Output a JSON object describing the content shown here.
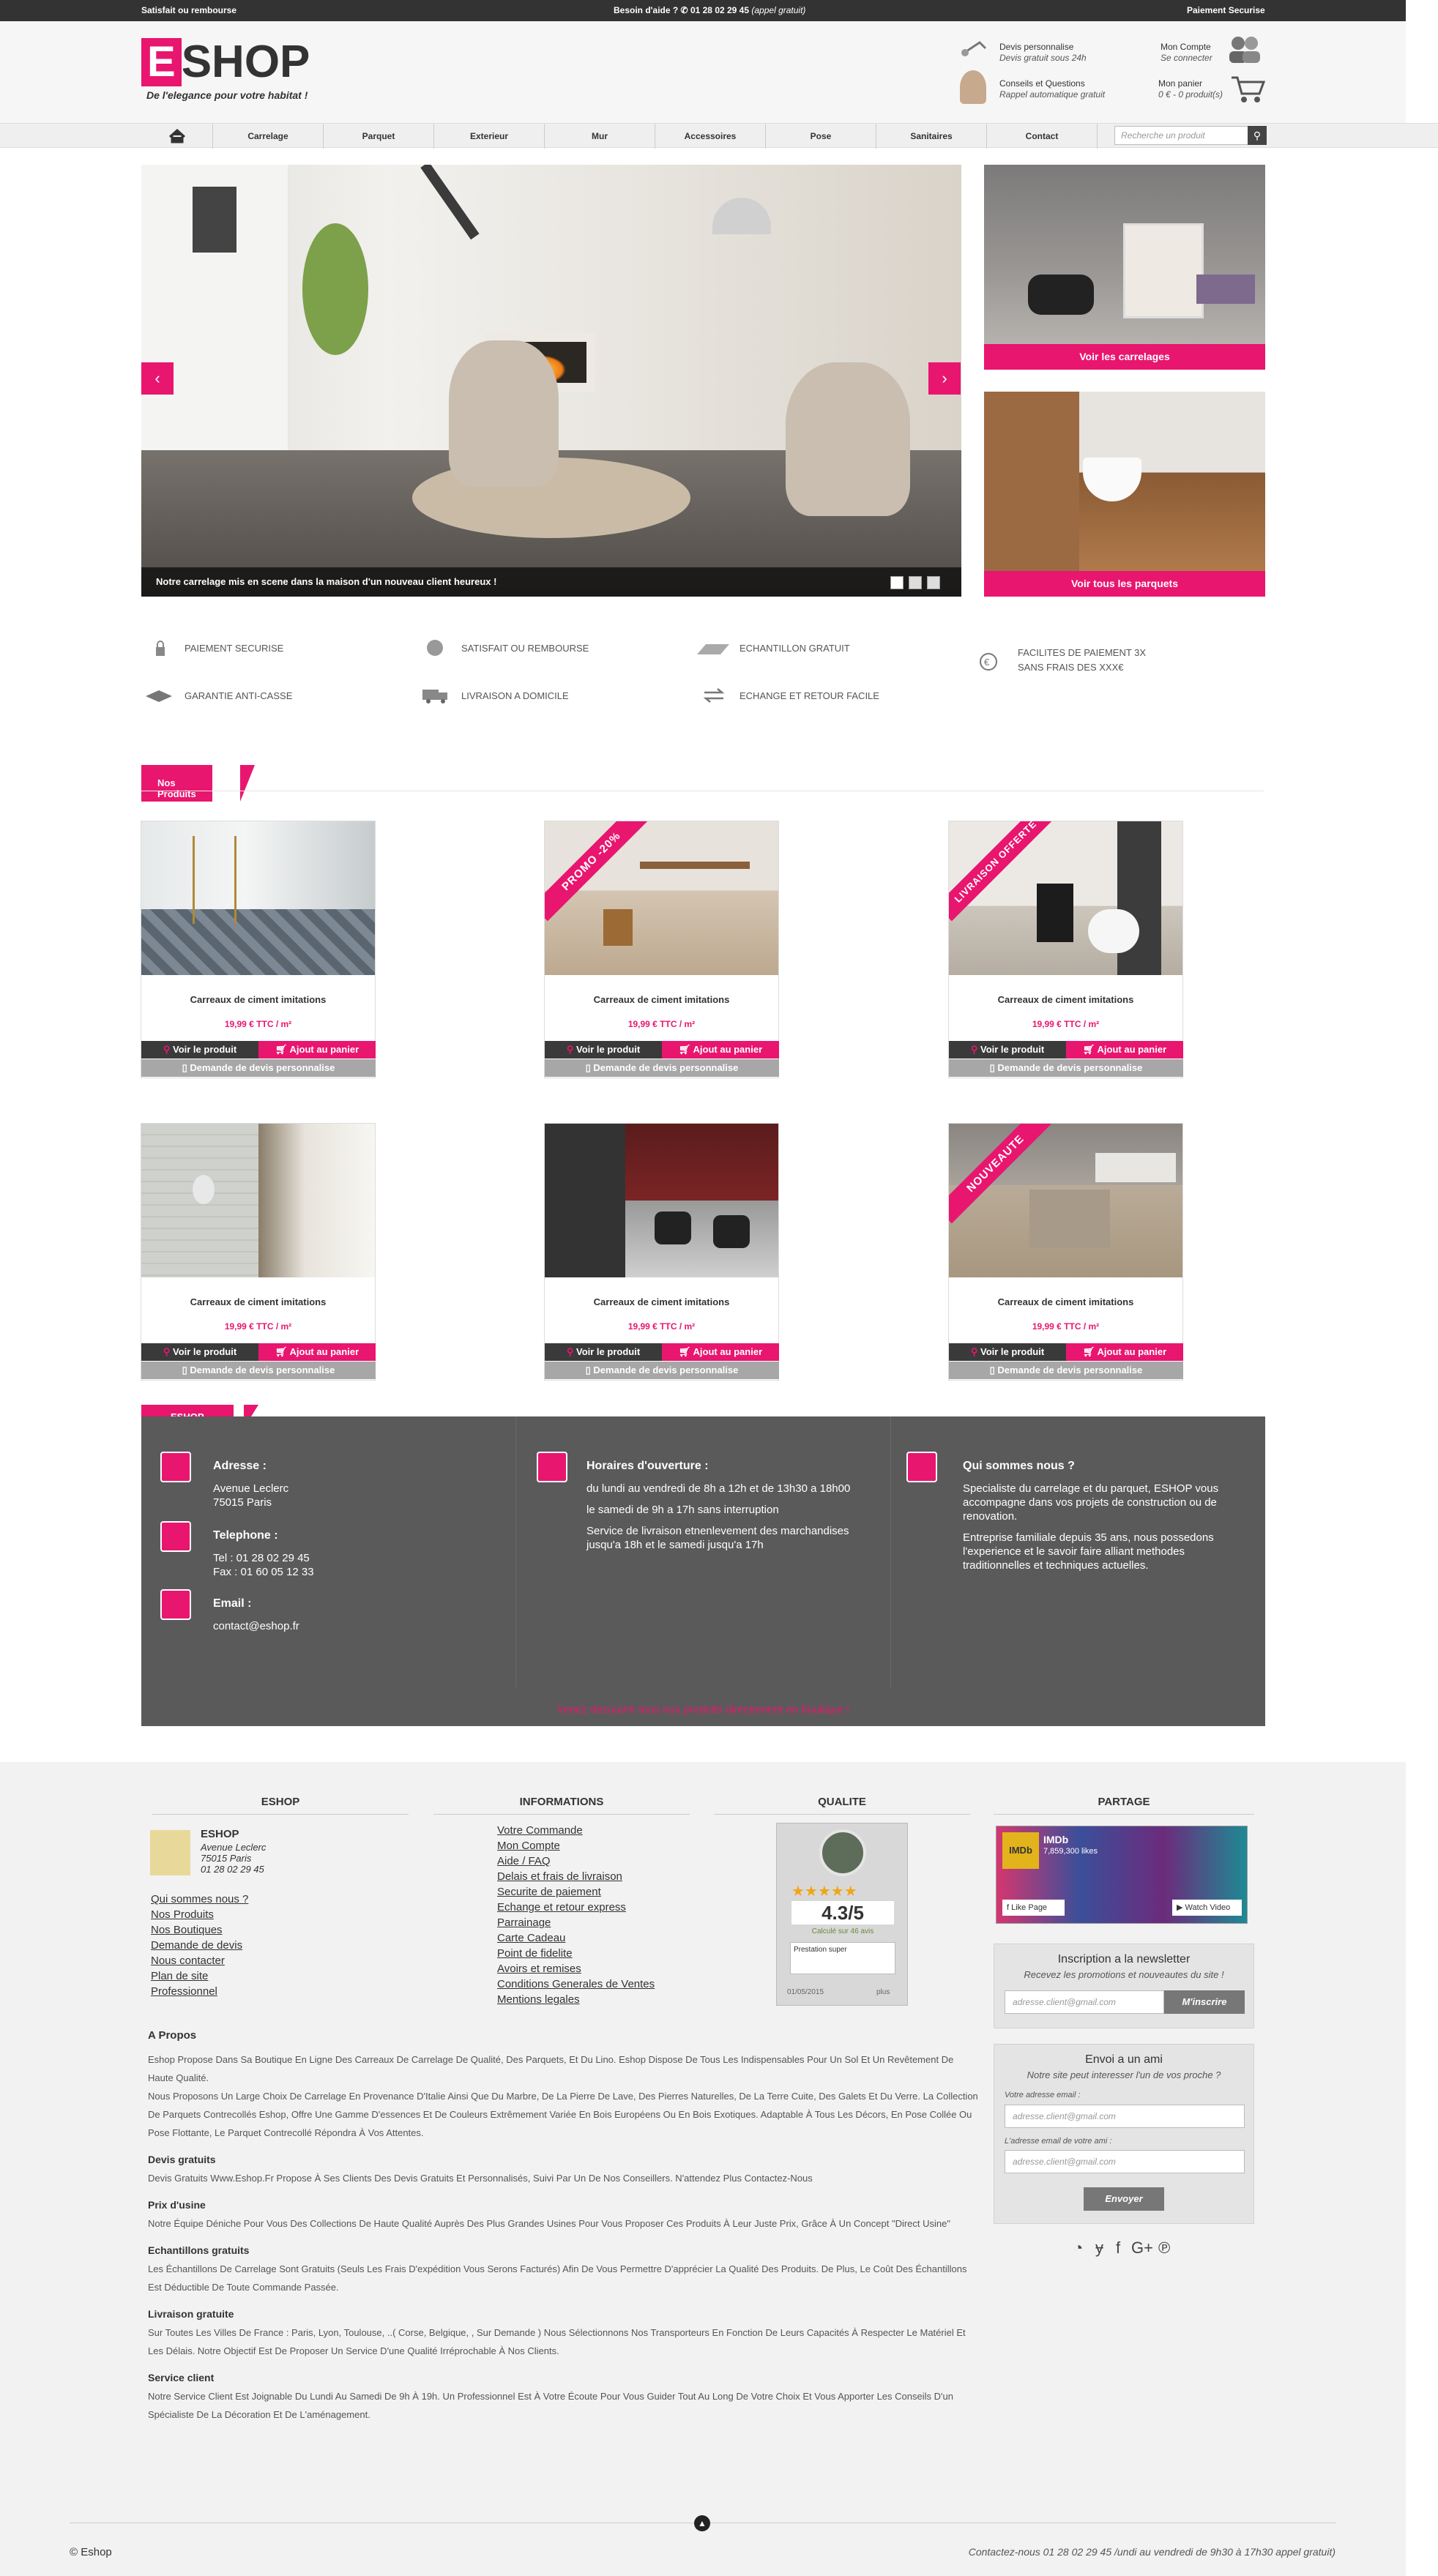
{
  "topbar": {
    "left": "Satisfait ou rembourse",
    "center_prefix": "Besoin d'aide ?",
    "center_phone": "01 28 02 29 45",
    "center_note": "(appel gratuit)",
    "right": "Paiement Securise"
  },
  "header": {
    "logo_letter": "E",
    "logo_rest": "SHOP",
    "slogan": "De l'elegance pour votre habitat !",
    "devis_title": "Devis personnalise",
    "devis_sub": "Devis gratuit sous 24h",
    "conseils_title": "Conseils et Questions",
    "conseils_sub": "Rappel automatique gratuit",
    "account_title": "Mon Compte",
    "account_sub": "Se connecter",
    "cart_title": "Mon panier",
    "cart_sub": "0 € - 0 produit(s)"
  },
  "nav": {
    "home_icon": "home-icon",
    "items": [
      "Carrelage",
      "Parquet",
      "Exterieur",
      "Mur",
      "Accessoires",
      "Pose",
      "Sanitaires",
      "Contact"
    ],
    "search_placeholder": "Recherche un produit"
  },
  "slider": {
    "caption": "Notre carrelage mis en scene dans la maison d'un nouveau client heureux !",
    "prev": "‹",
    "next": "›"
  },
  "side": {
    "carrelages": "Voir les carrelages",
    "parquets": "Voir tous les parquets"
  },
  "features": [
    "PAIEMENT SECURISE",
    "SATISFAIT OU REMBOURSE",
    "ECHANTILLON GRATUIT",
    "FACILITES DE PAIEMENT 3X SANS FRAIS DES XXX€",
    "GARANTIE ANTI-CASSE",
    "LIVRAISON A DOMICILE",
    "ECHANGE ET RETOUR FACILE"
  ],
  "products_section": {
    "title": "Nos Produits"
  },
  "products": [
    {
      "name": "Carreaux de ciment imitations",
      "price": "19,99 € TTC / m²",
      "ribbon": ""
    },
    {
      "name": "Carreaux de ciment imitations",
      "price": "19,99 € TTC / m²",
      "ribbon": "PROMO -20%"
    },
    {
      "name": "Carreaux de ciment imitations",
      "price": "19,99 € TTC / m²",
      "ribbon": "LIVRAISON OFFERTE"
    },
    {
      "name": "Carreaux de ciment imitations",
      "price": "19,99 € TTC / m²",
      "ribbon": ""
    },
    {
      "name": "Carreaux de ciment imitations",
      "price": "19,99 € TTC / m²",
      "ribbon": ""
    },
    {
      "name": "Carreaux de ciment imitations",
      "price": "19,99 € TTC / m²",
      "ribbon": "NOUVEAUTE"
    }
  ],
  "product_buttons": {
    "view": "Voir le produit",
    "cart": "Ajout au panier",
    "quote": "Demande de devis personnalise"
  },
  "eshop_section": {
    "title": "ESHOP",
    "address_title": "Adresse :",
    "address_l1": "Avenue Leclerc",
    "address_l2": "75015 Paris",
    "phone_title": "Telephone :",
    "phone_l1": "Tel : 01 28 02 29 45",
    "phone_l2": "Fax : 01 60 05 12 33",
    "email_title": "Email :",
    "email": "contact@eshop.fr",
    "hours_title": "Horaires d'ouverture :",
    "hours_l1": "du lundi au vendredi de 8h a 12h et de 13h30 a 18h00",
    "hours_l2": "le samedi de 9h a 17h sans interruption",
    "hours_l3": "Service de livraison etnenlevement des marchandises jusqu'a 18h et le samedi jusqu'a 17h",
    "about_title": "Qui sommes nous ?",
    "about_p1": "Specialiste du carrelage et du parquet, ESHOP vous accompagne dans vos projets de construction ou de renovation.",
    "about_p2": "Entreprise familiale depuis 35 ans, nous possedons l'experience et le savoir faire alliant methodes traditionnelles et techniques actuelles.",
    "bottom": "Venez decouvrir tous nos produits directement en boutique !"
  },
  "footer": {
    "col1_title": "ESHOP",
    "company": "ESHOP",
    "addr1": "Avenue Leclerc",
    "addr2": "75015 Paris",
    "addr3": "01 28 02 29 45",
    "col1_links": [
      "Qui sommes nous ?",
      "Nos Produits",
      "Nos Boutiques",
      "Demande de devis",
      "Nous contacter",
      "Plan de site",
      "Professionnel"
    ],
    "col2_title": "INFORMATIONS",
    "col2_links": [
      "Votre Commande",
      "Mon Compte",
      "Aide / FAQ",
      "Delais et frais de livraison",
      "Securite de paiement",
      "Echange et retour express",
      "Parrainage",
      "Carte Cadeau",
      "Point de fidelite",
      "Avoirs et remises",
      "Conditions Generales de Ventes",
      "Mentions legales"
    ],
    "col3_title": "QUALITE",
    "rating": "4.3/5",
    "rating_sub": "Calculé sur 46 avis",
    "review_text": "Prestation super",
    "review_date": "01/05/2015",
    "review_more": "plus",
    "col4_title": "PARTAGE",
    "fb_page": "IMDb",
    "fb_likes": "7,859,300 likes",
    "fb_like": "Like Page",
    "fb_watch": "Watch Video",
    "newsletter_title": "Inscription a la newsletter",
    "newsletter_sub": "Recevez les promotions et nouveautes du site !",
    "newsletter_placeholder": "adresse.client@gmail.com",
    "newsletter_btn": "M'inscrire",
    "friend_title": "Envoi a un ami",
    "friend_sub": "Notre site peut interesser l'un de vos proche ?",
    "friend_label1": "Votre adresse email :",
    "friend_ph1": "adresse.client@gmail.com",
    "friend_label2": "L'adresse email de votre ami :",
    "friend_ph2": "adresse.client@gmail.com",
    "friend_btn": "Envoyer",
    "social_icons": [
      "rss-icon",
      "twitter-icon",
      "facebook-icon",
      "google-plus-icon",
      "pinterest-icon"
    ],
    "copyright": "© Eshop",
    "contact_line": "Contactez-nous 01 28 02 29 45 /undi au vendredi de 9h30 à 17h30 appel gratuit)"
  },
  "apropos": {
    "title": "A Propos",
    "p1": "Eshop Propose Dans Sa Boutique En Ligne Des Carreaux De Carrelage De Qualité, Des Parquets, Et Du Lino. Eshop Dispose De Tous Les Indispensables Pour Un Sol Et Un Revêtement De Haute Qualité.",
    "p2": "Nous Proposons Un Large Choix De Carrelage En Provenance D'Italie Ainsi Que Du Marbre, De La Pierre De Lave, Des Pierres Naturelles, De La Terre Cuite, Des Galets Et Du Verre. La Collection De Parquets Contrecollés Eshop, Offre Une Gamme D'essences Et De Couleurs Extrêmement Variée En Bois Européens Ou En Bois Exotiques. Adaptable À Tous Les Décors, En Pose Collée Ou Pose Flottante, Le Parquet Contrecollé Répondra À Vos Attentes.",
    "h_devis": "Devis gratuits",
    "p_devis": "Devis Gratuits Www.Eshop.Fr Propose À Ses Clients Des Devis Gratuits Et Personnalisés, Suivi Par Un De Nos Conseillers. N'attendez Plus Contactez-Nous",
    "h_prix": "Prix d'usine",
    "p_prix": "Notre Équipe Déniche Pour Vous Des Collections De Haute Qualité Auprès Des Plus Grandes Usines Pour Vous Proposer Ces Produits À Leur Juste Prix, Grâce À Un Concept \"Direct Usine\"",
    "h_ech": "Echantillons gratuits",
    "p_ech": "Les Échantillons De Carrelage Sont Gratuits (Seuls Les Frais D'expédition Vous Serons Facturés) Afin De Vous Permettre D'apprécier La Qualité Des Produits. De Plus, Le Coût Des Échantillons Est Déductible De Toute Commande Passée.",
    "h_liv": "Livraison gratuite",
    "p_liv": "Sur Toutes Les Villes De France : Paris, Lyon, Toulouse, ..( Corse, Belgique, , Sur Demande ) Nous Sélectionnons Nos Transporteurs En Fonction De Leurs Capacités À Respecter Le Matériel Et Les Délais. Notre Objectif Est De Proposer Un Service D'une Qualité Irréprochable À Nos Clients.",
    "h_srv": "Service client",
    "p_srv": "Notre Service Client Est Joignable Du Lundi Au Samedi De 9h À 19h. Un Professionnel Est À Votre Écoute Pour Vous Guider Tout Au Long De Votre Choix Et Vous Apporter Les Conseils D'un Spécialiste De La Décoration Et De L'aménagement."
  }
}
